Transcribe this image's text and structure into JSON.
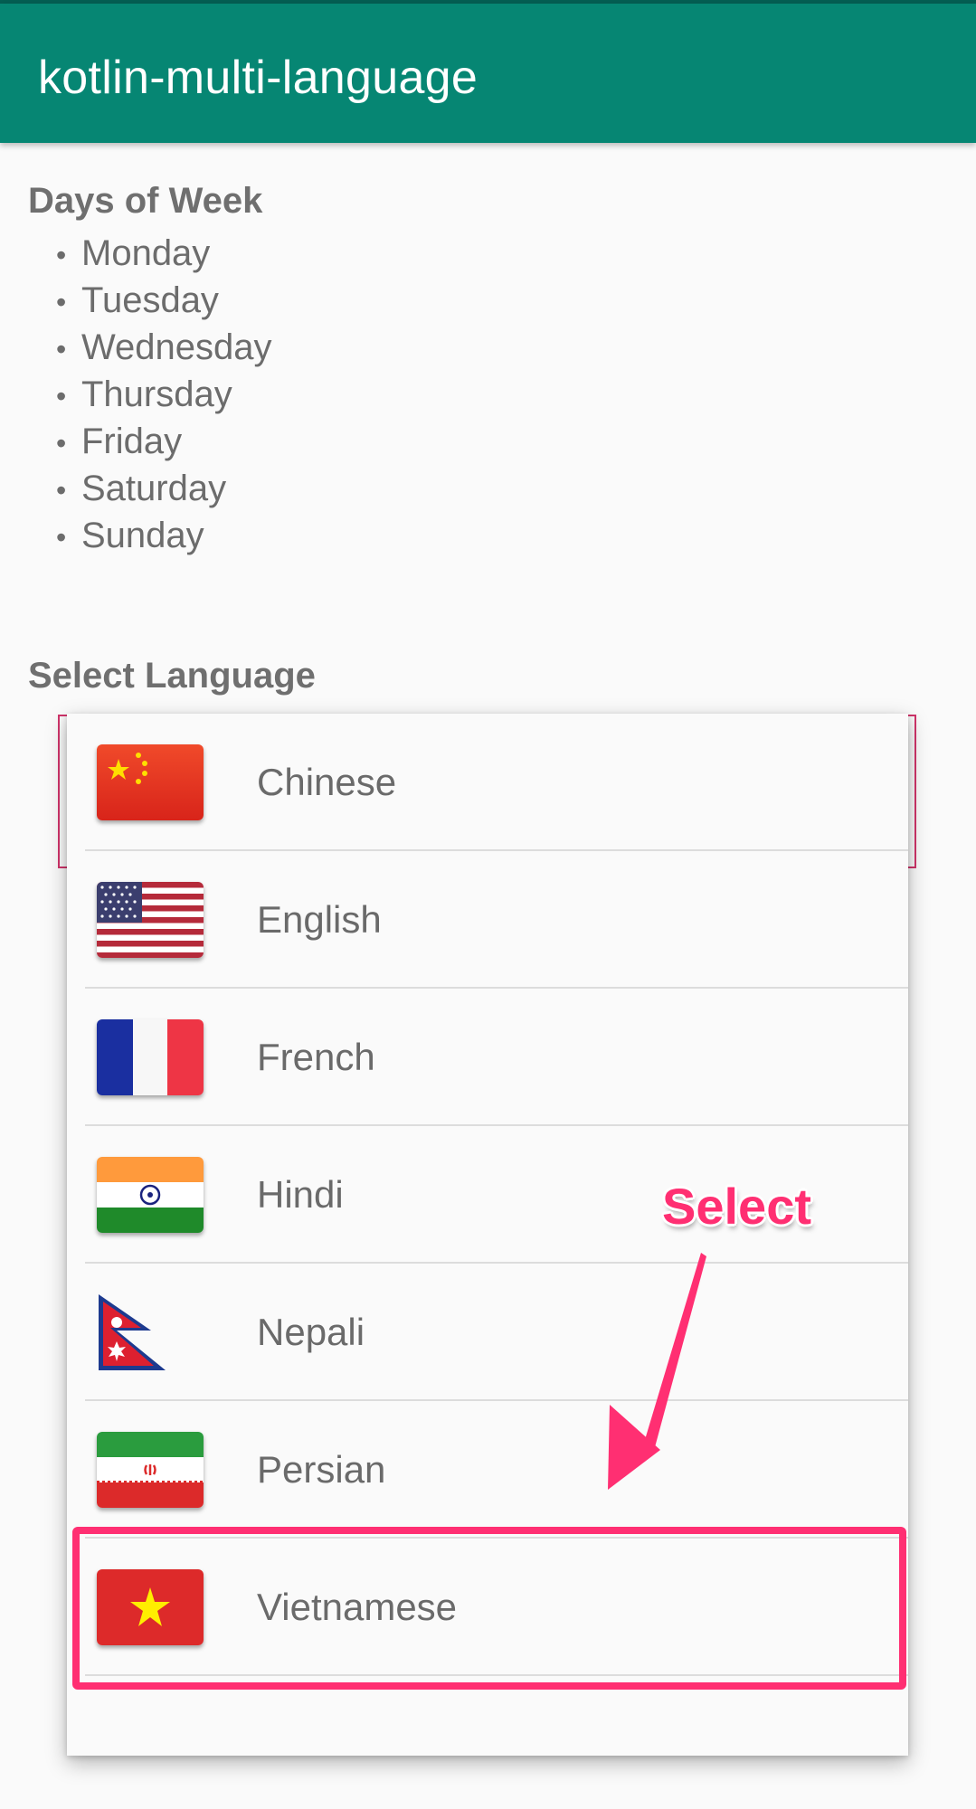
{
  "app": {
    "title": "kotlin-multi-language"
  },
  "days_section": {
    "title": "Days of Week",
    "bullet": "•",
    "days": [
      "Monday",
      "Tuesday",
      "Wednesday",
      "Thursday",
      "Friday",
      "Saturday",
      "Sunday"
    ]
  },
  "language_section": {
    "title": "Select Language"
  },
  "languages": [
    {
      "label": "Chinese",
      "flag_icon": "china-flag-icon"
    },
    {
      "label": "English",
      "flag_icon": "usa-flag-icon"
    },
    {
      "label": "French",
      "flag_icon": "france-flag-icon"
    },
    {
      "label": "Hindi",
      "flag_icon": "india-flag-icon"
    },
    {
      "label": "Nepali",
      "flag_icon": "nepal-flag-icon"
    },
    {
      "label": "Persian",
      "flag_icon": "iran-flag-icon"
    },
    {
      "label": "Vietnamese",
      "flag_icon": "vietnam-flag-icon"
    }
  ],
  "annotation": {
    "text": "Select",
    "color": "#ff2f72"
  },
  "colors": {
    "appbar": "#068673",
    "accent": "#ff2f72",
    "text": "#6a6a6a"
  }
}
